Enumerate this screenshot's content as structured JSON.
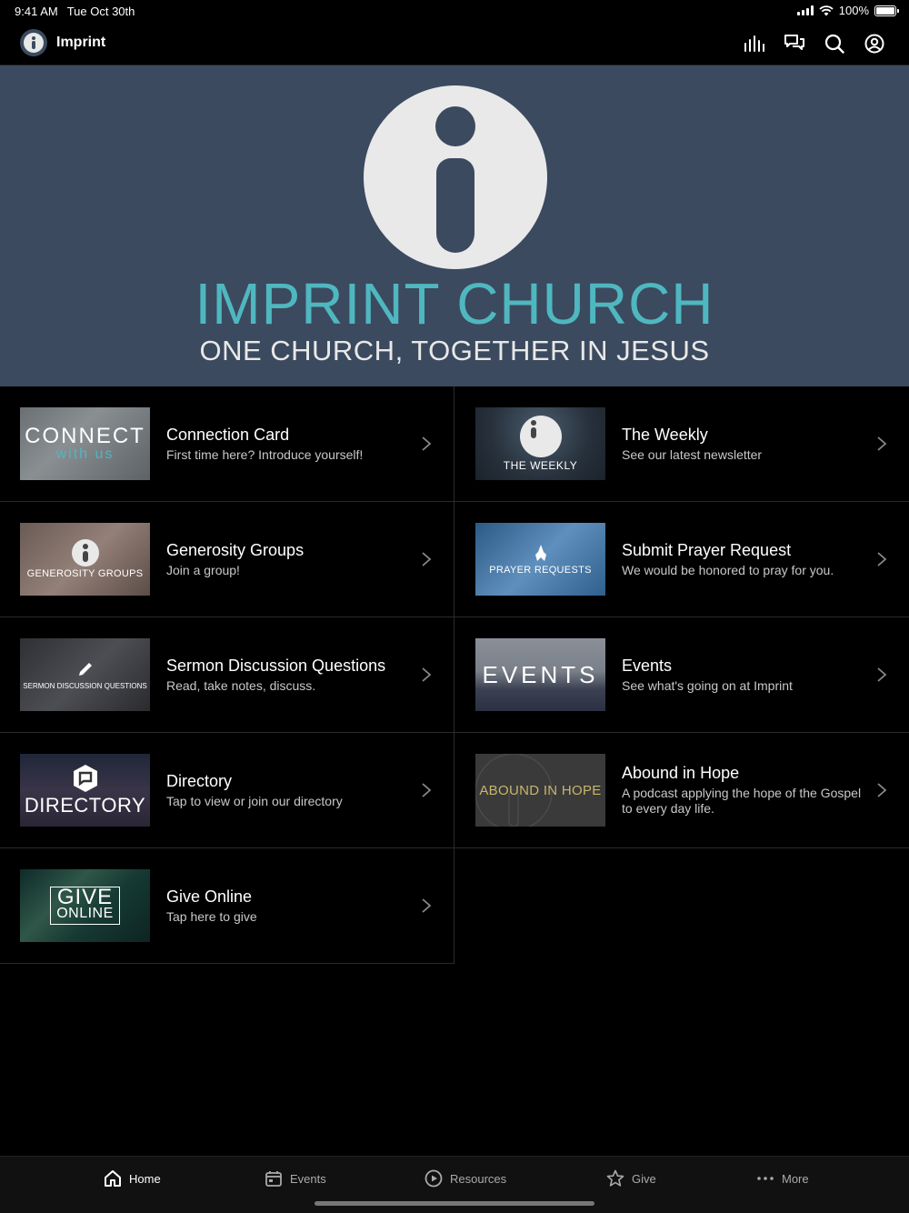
{
  "status_bar": {
    "time": "9:41 AM",
    "date": "Tue Oct 30th",
    "battery": "100%"
  },
  "nav": {
    "brand_name": "Imprint",
    "icons": [
      "audio-bars-icon",
      "chat-icon",
      "search-icon",
      "account-icon"
    ]
  },
  "hero": {
    "title": "IMPRINT CHURCH",
    "subtitle": "ONE CHURCH, TOGETHER IN JESUS"
  },
  "items": [
    {
      "title": "Connection Card",
      "subtitle": "First time here? Introduce yourself!",
      "thumb_big": "CONNECT",
      "thumb_small": "with us"
    },
    {
      "title": "The Weekly",
      "subtitle": "See our latest newsletter",
      "thumb_label": "THE WEEKLY"
    },
    {
      "title": "Generosity Groups",
      "subtitle": "Join a group!",
      "thumb_label": "GENEROSITY GROUPS"
    },
    {
      "title": "Submit Prayer Request",
      "subtitle": "We would be honored to pray for you.",
      "thumb_label": "PRAYER REQUESTS"
    },
    {
      "title": "Sermon Discussion Questions",
      "subtitle": "Read, take notes, discuss.",
      "thumb_label": "SERMON DISCUSSION QUESTIONS"
    },
    {
      "title": "Events",
      "subtitle": "See what's going on at Imprint",
      "thumb_label": "EVENTS"
    },
    {
      "title": "Directory",
      "subtitle": "Tap to view or join our directory",
      "thumb_label": "DIRECTORY"
    },
    {
      "title": "Abound in Hope",
      "subtitle": "A podcast applying the hope of the Gospel to every day life.",
      "thumb_label": "ABOUND IN HOPE"
    },
    {
      "title": "Give Online",
      "subtitle": "Tap here to give",
      "thumb_big": "GIVE",
      "thumb_small": "ONLINE"
    }
  ],
  "tabs": [
    {
      "label": "Home",
      "icon": "home-icon",
      "active": true
    },
    {
      "label": "Events",
      "icon": "calendar-icon"
    },
    {
      "label": "Resources",
      "icon": "play-circle-icon"
    },
    {
      "label": "Give",
      "icon": "star-icon"
    },
    {
      "label": "More",
      "icon": "more-dots-icon"
    }
  ],
  "colors": {
    "accent": "#4fb7c0",
    "hero_bg": "#3b4a5e",
    "background": "#000000"
  }
}
